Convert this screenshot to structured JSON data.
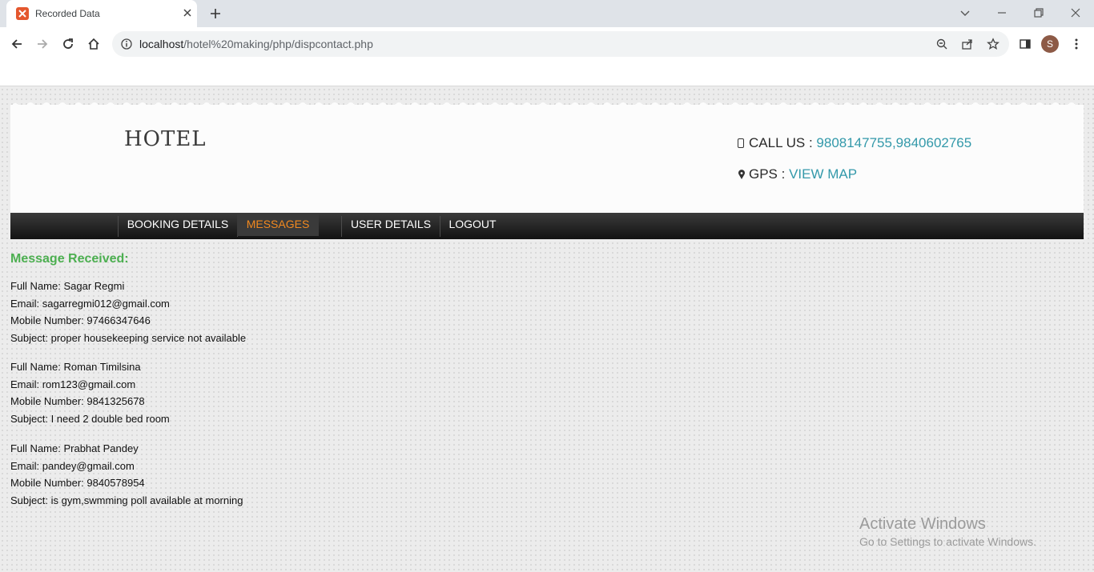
{
  "browser": {
    "tab_title": "Recorded Data",
    "url_host": "localhost",
    "url_path": "/hotel%20making/php/dispcontact.php",
    "avatar_letter": "S"
  },
  "header": {
    "logo": "HOTEL",
    "call_label": "CALL US : ",
    "call_numbers": "9808147755,9840602765",
    "gps_label": "GPS : ",
    "gps_link": "VIEW MAP"
  },
  "nav": {
    "items": [
      {
        "label": "BOOKING DETAILS",
        "active": false
      },
      {
        "label": "MESSAGES",
        "active": true
      },
      {
        "label": "USER DETAILS",
        "active": false
      },
      {
        "label": "LOGOUT",
        "active": false
      }
    ]
  },
  "messages": {
    "heading": "Message Received:",
    "entries": [
      {
        "name": "Full Name: Sagar Regmi",
        "email": "Email: sagarregmi012@gmail.com",
        "mobile": "Mobile Number: 97466347646",
        "subject": "Subject: proper housekeeping service not available"
      },
      {
        "name": "Full Name: Roman Timilsina",
        "email": "Email: rom123@gmail.com",
        "mobile": "Mobile Number: 9841325678",
        "subject": "Subject: I need 2 double bed room"
      },
      {
        "name": "Full Name: Prabhat Pandey",
        "email": "Email: pandey@gmail.com",
        "mobile": "Mobile Number: 9840578954",
        "subject": "Subject: is gym,swmming poll available at morning"
      }
    ]
  },
  "watermark": {
    "line1": "Activate Windows",
    "line2": "Go to Settings to activate Windows."
  },
  "colors": {
    "accent_green": "#4caf50",
    "link_teal": "#3399aa",
    "active_nav": "#f2891f"
  }
}
